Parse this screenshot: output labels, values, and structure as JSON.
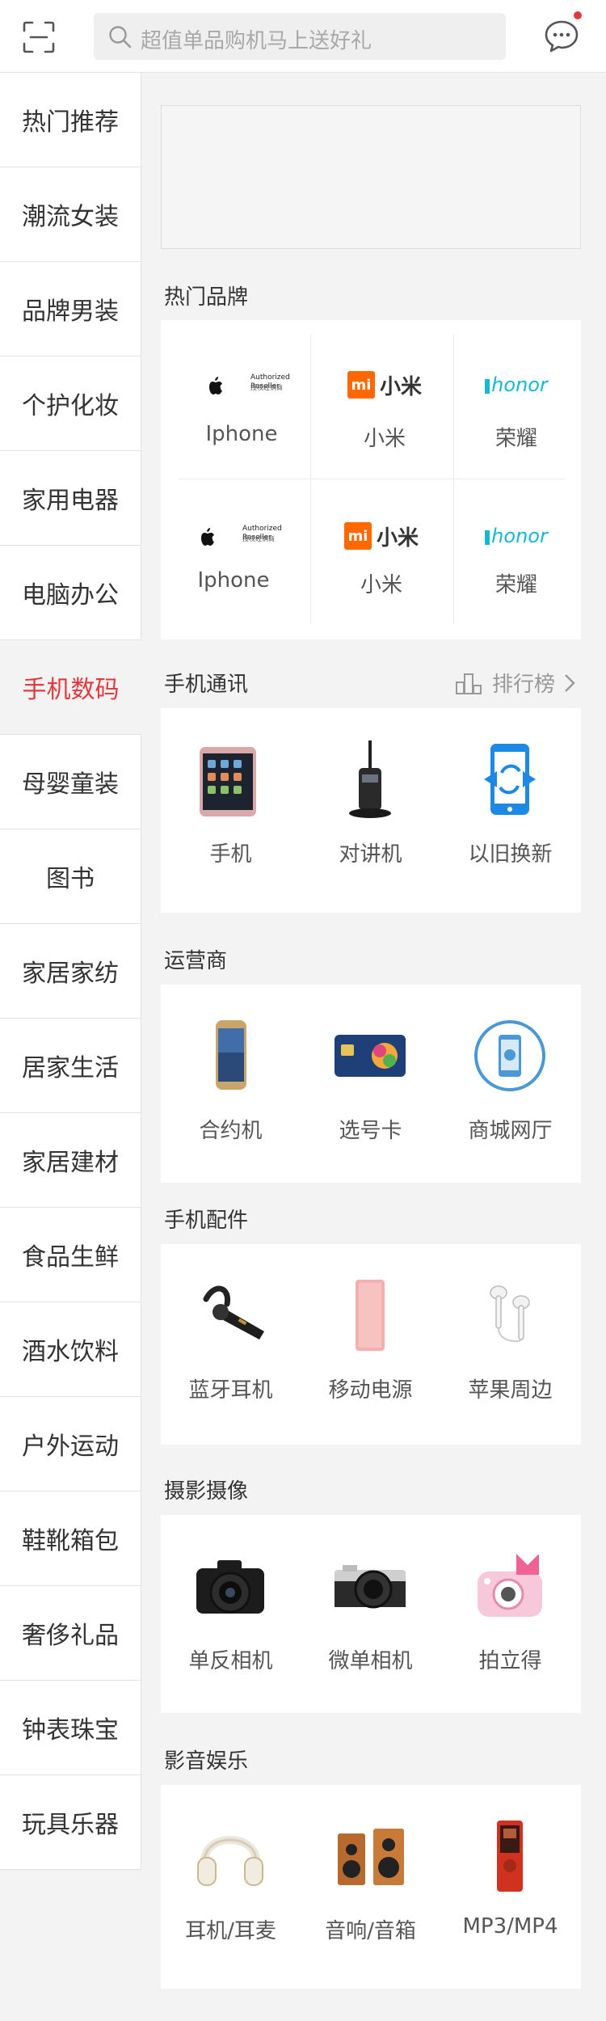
{
  "search": {
    "placeholder": "超值单品购机马上送好礼"
  },
  "icons": {
    "scan": "scan-icon",
    "search": "search-icon",
    "message": "chat-bubble-icon"
  },
  "colors": {
    "accent": "#e4393c"
  },
  "sidebar": {
    "items": [
      {
        "label": "热门推荐"
      },
      {
        "label": "潮流女装"
      },
      {
        "label": "品牌男装"
      },
      {
        "label": "个护化妆"
      },
      {
        "label": "家用电器"
      },
      {
        "label": "电脑办公"
      },
      {
        "label": "手机数码",
        "active": true
      },
      {
        "label": "母婴童装"
      },
      {
        "label": "图书"
      },
      {
        "label": "家居家纺"
      },
      {
        "label": "居家生活"
      },
      {
        "label": "家居建材"
      },
      {
        "label": "食品生鲜"
      },
      {
        "label": "酒水饮料"
      },
      {
        "label": "户外运动"
      },
      {
        "label": "鞋靴箱包"
      },
      {
        "label": "奢侈礼品"
      },
      {
        "label": "钟表珠宝"
      },
      {
        "label": "玩具乐器"
      }
    ]
  },
  "hot_brands": {
    "title": "热门品牌",
    "items": [
      {
        "name": "Iphone",
        "logo": "Authorized Reseller",
        "logo_sub": "授权经销商"
      },
      {
        "name": "小米",
        "logo": "小米",
        "logo_mark": "mi"
      },
      {
        "name": "荣耀",
        "logo": "honor"
      },
      {
        "name": "Iphone",
        "logo": "Authorized Reseller",
        "logo_sub": "授权经销商"
      },
      {
        "name": "小米",
        "logo": "小米",
        "logo_mark": "mi"
      },
      {
        "name": "荣耀",
        "logo": "honor"
      }
    ]
  },
  "phones": {
    "title": "手机通讯",
    "rank_label": "排行榜",
    "items": [
      {
        "label": "手机",
        "icon": "smartphone-icon"
      },
      {
        "label": "对讲机",
        "icon": "walkie-talkie-icon"
      },
      {
        "label": "以旧换新",
        "icon": "phone-exchange-icon"
      }
    ]
  },
  "carrier": {
    "title": "运营商",
    "items": [
      {
        "label": "合约机",
        "icon": "contract-phone-icon"
      },
      {
        "label": "选号卡",
        "icon": "sim-card-icon"
      },
      {
        "label": "商城网厅",
        "icon": "online-hall-icon"
      }
    ]
  },
  "accessories": {
    "title": "手机配件",
    "items": [
      {
        "label": "蓝牙耳机",
        "icon": "bluetooth-headset-icon"
      },
      {
        "label": "移动电源",
        "icon": "power-bank-icon"
      },
      {
        "label": "苹果周边",
        "icon": "earphones-icon"
      }
    ]
  },
  "photo": {
    "title": "摄影摄像",
    "items": [
      {
        "label": "单反相机",
        "icon": "dslr-camera-icon"
      },
      {
        "label": "微单相机",
        "icon": "mirrorless-camera-icon"
      },
      {
        "label": "拍立得",
        "icon": "instant-camera-icon"
      }
    ]
  },
  "av": {
    "title": "影音娱乐",
    "items": [
      {
        "label": "耳机/耳麦",
        "icon": "headphones-icon"
      },
      {
        "label": "音响/音箱",
        "icon": "speakers-icon"
      },
      {
        "label": "MP3/MP4",
        "icon": "mp3-player-icon"
      }
    ]
  }
}
